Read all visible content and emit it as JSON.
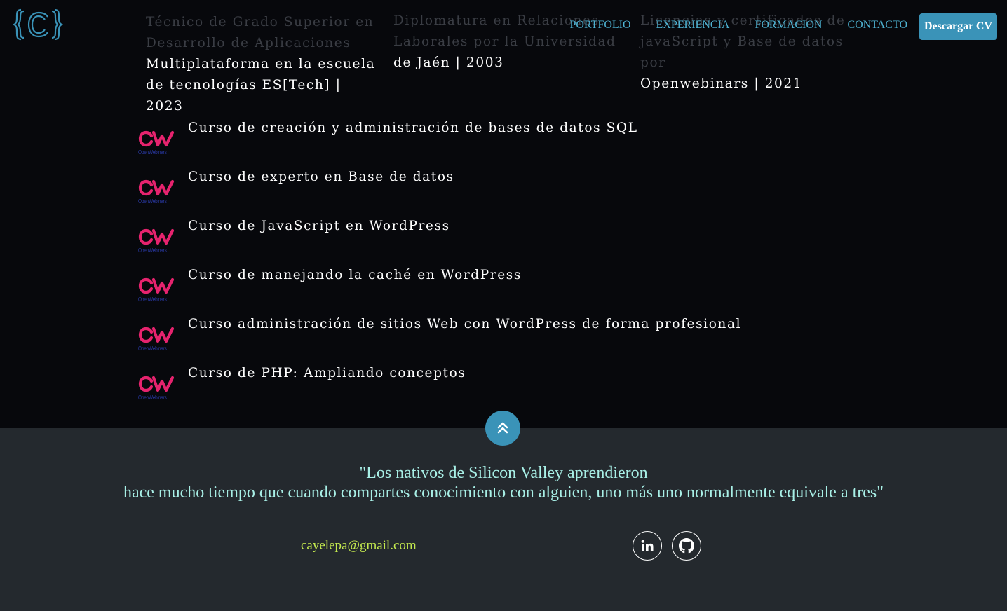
{
  "nav": {
    "links": [
      "PORTFOLIO",
      "EXPERIENCIA",
      "FORMACION",
      "CONTACTO"
    ],
    "cv_button": "Descargar CV"
  },
  "education": [
    {
      "faded_lines": [
        "Técnico de Grado Superior en",
        "Desarrollo de Aplicaciones"
      ],
      "bright_lines": [
        "Multiplataforma en la escuela",
        "de tecnologías ES[Tech] | 2023"
      ]
    },
    {
      "faded_lines": [
        "Diplomatura en Relaciones",
        "Laborales por la Universidad"
      ],
      "bright_lines": [
        "de Jaén | 2003"
      ]
    },
    {
      "faded_lines": [
        "Licencias y certificados de",
        "javaScript y Base de datos por"
      ],
      "bright_lines": [
        "Openwebinars | 2021"
      ]
    }
  ],
  "courses": {
    "logo_text": "OpenWebinars",
    "items": [
      "Curso de creación y administración de bases de datos SQL",
      "Curso de experto en Base de datos",
      "Curso de JavaScript en WordPress",
      "Curso de manejando la caché en WordPress",
      "Curso administración de sitios Web con WordPress de forma profesional",
      "Curso de PHP: Ampliando conceptos"
    ]
  },
  "footer": {
    "quote_line1": "\"Los nativos de Silicon Valley aprendieron",
    "quote_line2": "hace mucho tiempo que cuando compartes conocimiento con alguien, uno más uno normalmente equivale a tres\"",
    "email": "cayelepa@gmail.com"
  },
  "icons": {
    "logo": "curly-braces-c-logo",
    "back_to_top": "double-chevron-up-icon",
    "social": [
      "linkedin-icon",
      "github-icon"
    ]
  },
  "colors": {
    "accent": "#3a93b8",
    "nav_link": "#4eb3d3",
    "quote": "#a8efe6",
    "email": "#c3e84e",
    "ow_pink": "#e6236e",
    "ow_blue": "#2a3aa8"
  }
}
